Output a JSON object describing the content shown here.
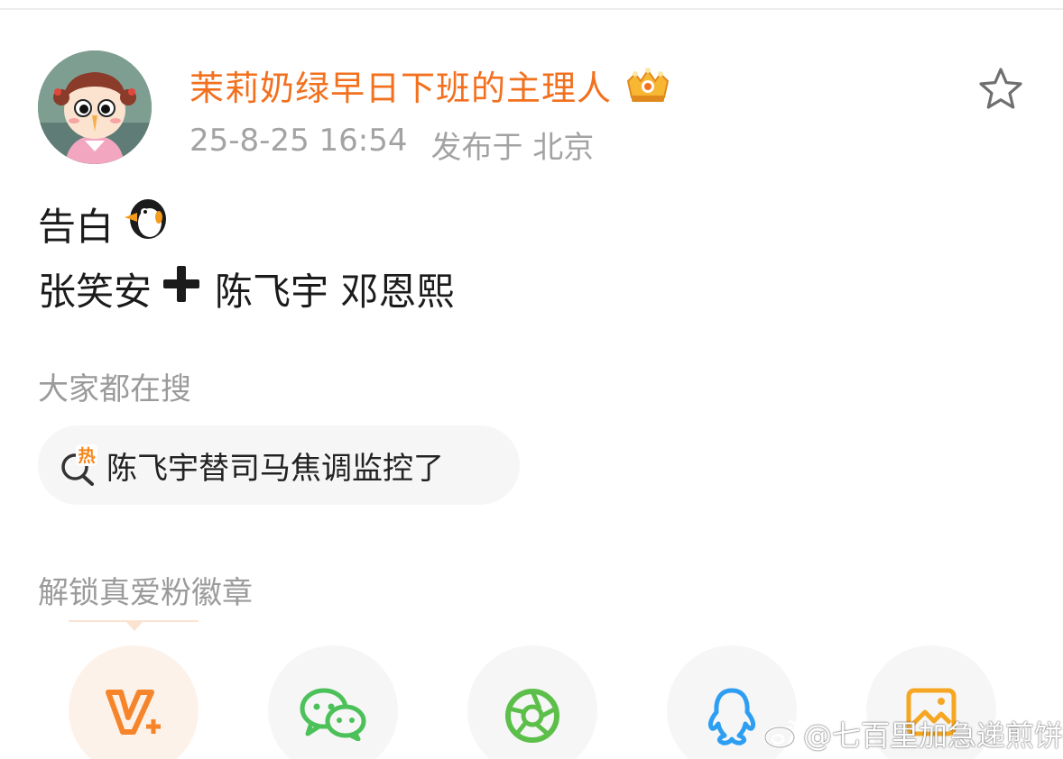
{
  "header": {
    "username": "茉莉奶绿早日下班的主理人",
    "timestamp": "25-8-25 16:54",
    "location": "发布于 北京",
    "username_color": "#f2701e"
  },
  "post": {
    "line1_text": "告白",
    "line1_emoji": "penguin-emoji",
    "line2_left": "张笑安",
    "line2_right": "陈飞宇 邓恩熙"
  },
  "search_section": {
    "title": "大家都在搜",
    "hot_badge": "热",
    "hot_query": "陈飞宇替司马焦调监控了"
  },
  "badge_section": {
    "title": "解锁真爱粉徽章"
  },
  "share_row": {
    "items": [
      {
        "icon": "weibo-vplus-icon",
        "color": "#f5842a"
      },
      {
        "icon": "wechat-icon",
        "color": "#4cc15a"
      },
      {
        "icon": "moments-icon",
        "color": "#5cbf4a"
      },
      {
        "icon": "qq-icon",
        "color": "#2e9ef2"
      },
      {
        "icon": "image-icon",
        "color": "#f5a623"
      }
    ]
  },
  "watermark": {
    "text": "@七百里加急递煎饼"
  }
}
